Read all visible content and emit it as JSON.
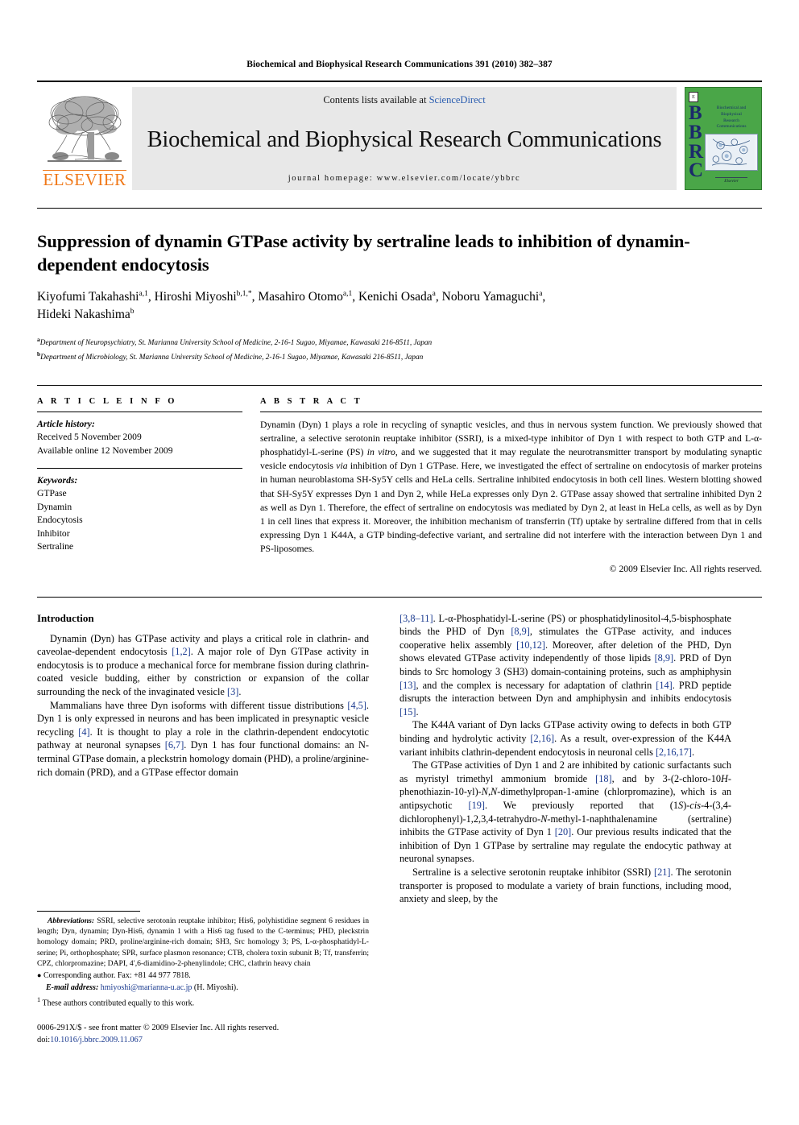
{
  "running_head": "Biochemical and Biophysical Research Communications 391 (2010) 382–387",
  "masthead": {
    "contents_prefix": "Contents lists available at ",
    "sciencedirect": "ScienceDirect",
    "journal_title": "Biochemical and Biophysical Research Communications",
    "homepage": "journal homepage: www.elsevier.com/locate/ybbrc",
    "elsevier_wordmark": "ELSEVIER",
    "cover": {
      "letters": "BBRC",
      "name_lines": [
        "Biochemical and",
        "Biophysical",
        "Research",
        "Communications"
      ],
      "publisher": "Elsevier",
      "bg_color": "#4aa648",
      "letter_color": "#1b2a6b"
    },
    "sciencedirect_color": "#2a5db0",
    "elsevier_orange": "#F07818"
  },
  "article": {
    "title": "Suppression of dynamin GTPase activity by sertraline leads to inhibition of dynamin-dependent endocytosis",
    "authors_line_1": "Kiyofumi Takahashi a,1, Hiroshi Miyoshi b,1,*, Masahiro Otomo a,1, Kenichi Osada a, Noboru Yamaguchi a,",
    "authors_line_2": "Hideki Nakashima b",
    "authors": [
      {
        "name": "Kiyofumi Takahashi",
        "sup": "a,1"
      },
      {
        "name": "Hiroshi Miyoshi",
        "sup": "b,1,*"
      },
      {
        "name": "Masahiro Otomo",
        "sup": "a,1"
      },
      {
        "name": "Kenichi Osada",
        "sup": "a"
      },
      {
        "name": "Noboru Yamaguchi",
        "sup": "a"
      },
      {
        "name": "Hideki Nakashima",
        "sup": "b"
      }
    ],
    "affiliations": [
      {
        "mark": "a",
        "text": "Department of Neuropsychiatry, St. Marianna University School of Medicine, 2-16-1 Sugao, Miyamae, Kawasaki 216-8511, Japan"
      },
      {
        "mark": "b",
        "text": "Department of Microbiology, St. Marianna University School of Medicine, 2-16-1 Sugao, Miyamae, Kawasaki 216-8511, Japan"
      }
    ]
  },
  "article_info": {
    "heading": "A R T I C L E    I N F O",
    "history_label": "Article history:",
    "history": [
      "Received 5 November 2009",
      "Available online 12 November 2009"
    ],
    "keywords_label": "Keywords:",
    "keywords": [
      "GTPase",
      "Dynamin",
      "Endocytosis",
      "Inhibitor",
      "Sertraline"
    ]
  },
  "abstract": {
    "heading": "A B S T R A C T",
    "text_parts": [
      {
        "t": "Dynamin (Dyn) 1 plays a role in recycling of synaptic vesicles, and thus in nervous system function. We previously showed that sertraline, a selective serotonin reuptake inhibitor (SSRI), is a mixed-type inhibitor of Dyn 1 with respect to both GTP and L-α-phosphatidyl-L-serine (PS) ",
        "style": "normal"
      },
      {
        "t": "in vitro",
        "style": "italic"
      },
      {
        "t": ", and we suggested that it may regulate the neurotransmitter transport by modulating synaptic vesicle endocytosis ",
        "style": "normal"
      },
      {
        "t": "via",
        "style": "italic"
      },
      {
        "t": " inhibition of Dyn 1 GTPase. Here, we investigated the effect of sertraline on endocytosis of marker proteins in human neuroblastoma SH-Sy5Y cells and HeLa cells. Sertraline inhibited endocytosis in both cell lines. Western blotting showed that SH-Sy5Y expresses Dyn 1 and Dyn 2, while HeLa expresses only Dyn 2. GTPase assay showed that sertraline inhibited Dyn 2 as well as Dyn 1. Therefore, the effect of sertraline on endocytosis was mediated by Dyn 2, at least in HeLa cells, as well as by Dyn 1 in cell lines that express it. Moreover, the inhibition mechanism of transferrin (Tf) uptake by sertraline differed from that in cells expressing Dyn 1 K44A, a GTP binding-defective variant, and sertraline did not interfere with the interaction between Dyn 1 and PS-liposomes.",
        "style": "normal"
      }
    ],
    "copyright": "© 2009 Elsevier Inc. All rights reserved."
  },
  "body": {
    "left_heading": "Introduction",
    "left_paragraphs": [
      [
        {
          "t": "Dynamin (Dyn) has GTPase activity and plays a critical role in clathrin- and caveolae-dependent endocytosis ",
          "style": "normal"
        },
        {
          "t": "[1,2]",
          "style": "ref"
        },
        {
          "t": ". A major role of Dyn GTPase activity in endocytosis is to produce a mechanical force for membrane fission during clathrin-coated vesicle budding, either by constriction or expansion of the collar surrounding the neck of the invaginated vesicle ",
          "style": "normal"
        },
        {
          "t": "[3]",
          "style": "ref"
        },
        {
          "t": ".",
          "style": "normal"
        }
      ],
      [
        {
          "t": "Mammalians have three Dyn isoforms with different tissue distributions ",
          "style": "normal"
        },
        {
          "t": "[4,5]",
          "style": "ref"
        },
        {
          "t": ". Dyn 1 is only expressed in neurons and has been implicated in presynaptic vesicle recycling ",
          "style": "normal"
        },
        {
          "t": "[4]",
          "style": "ref"
        },
        {
          "t": ". It is thought to play a role in the clathrin-dependent endocytotic pathway at neuronal synapses ",
          "style": "normal"
        },
        {
          "t": "[6,7]",
          "style": "ref"
        },
        {
          "t": ". Dyn 1 has four functional domains: an N-terminal GTPase domain, a pleckstrin homology domain (PHD), a proline/arginine-rich domain (PRD), and a GTPase effector domain",
          "style": "normal"
        }
      ]
    ],
    "right_paragraphs": [
      [
        {
          "t": "[3,8–11]",
          "style": "ref"
        },
        {
          "t": ". L-α-Phosphatidyl-L-serine (PS) or phosphatidylinositol-4,5-bisphosphate binds the PHD of Dyn ",
          "style": "normal"
        },
        {
          "t": "[8,9]",
          "style": "ref"
        },
        {
          "t": ", stimulates the GTPase activity, and induces cooperative helix assembly ",
          "style": "normal"
        },
        {
          "t": "[10,12]",
          "style": "ref"
        },
        {
          "t": ". Moreover, after deletion of the PHD, Dyn shows elevated GTPase activity independently of those lipids ",
          "style": "normal"
        },
        {
          "t": "[8,9]",
          "style": "ref"
        },
        {
          "t": ". PRD of Dyn binds to Src homology 3 (SH3) domain-containing proteins, such as amphiphysin ",
          "style": "normal"
        },
        {
          "t": "[13]",
          "style": "ref"
        },
        {
          "t": ", and the complex is necessary for adaptation of clathrin ",
          "style": "normal"
        },
        {
          "t": "[14]",
          "style": "ref"
        },
        {
          "t": ". PRD peptide disrupts the interaction between Dyn and amphiphysin and inhibits endocytosis ",
          "style": "normal"
        },
        {
          "t": "[15]",
          "style": "ref"
        },
        {
          "t": ".",
          "style": "normal"
        }
      ],
      [
        {
          "t": "The K44A variant of Dyn lacks GTPase activity owing to defects in both GTP binding and hydrolytic activity ",
          "style": "normal"
        },
        {
          "t": "[2,16]",
          "style": "ref"
        },
        {
          "t": ". As a result, over-expression of the K44A variant inhibits clathrin-dependent endocytosis in neuronal cells ",
          "style": "normal"
        },
        {
          "t": "[2,16,17]",
          "style": "ref"
        },
        {
          "t": ".",
          "style": "normal"
        }
      ],
      [
        {
          "t": "The GTPase activities of Dyn 1 and 2 are inhibited by cationic surfactants such as myristyl trimethyl ammonium bromide ",
          "style": "normal"
        },
        {
          "t": "[18]",
          "style": "ref"
        },
        {
          "t": ", and by 3-(2-chloro-10",
          "style": "normal"
        },
        {
          "t": "H",
          "style": "italic"
        },
        {
          "t": "-phenothiazin-10-yl)-",
          "style": "normal"
        },
        {
          "t": "N,N",
          "style": "italic"
        },
        {
          "t": "-dimethylpropan-1-amine (chlorpromazine), which is an antipsychotic ",
          "style": "normal"
        },
        {
          "t": "[19]",
          "style": "ref"
        },
        {
          "t": ". We previously reported that (1",
          "style": "normal"
        },
        {
          "t": "S",
          "style": "italic"
        },
        {
          "t": ")-",
          "style": "normal"
        },
        {
          "t": "cis",
          "style": "italic"
        },
        {
          "t": "-4-(3,4-dichlorophenyl)-1,2,3,4-tetrahydro-",
          "style": "normal"
        },
        {
          "t": "N",
          "style": "italic"
        },
        {
          "t": "-methyl-1-naphthalenamine (sertraline) inhibits the GTPase activity of Dyn 1 ",
          "style": "normal"
        },
        {
          "t": "[20]",
          "style": "ref"
        },
        {
          "t": ". Our previous results indicated that the inhibition of Dyn 1 GTPase by sertraline may regulate the endocytic pathway at neuronal synapses.",
          "style": "normal"
        }
      ],
      [
        {
          "t": "Sertraline is a selective serotonin reuptake inhibitor (SSRI) ",
          "style": "normal"
        },
        {
          "t": "[21]",
          "style": "ref"
        },
        {
          "t": ". The serotonin transporter is proposed to modulate a variety of brain functions, including mood, anxiety and sleep, by the",
          "style": "normal"
        }
      ]
    ]
  },
  "footnotes": {
    "abbrev_label": "Abbreviations:",
    "abbrev_text": " SSRI, selective serotonin reuptake inhibitor; His6, polyhistidine segment 6 residues in length; Dyn, dynamin; Dyn-His6, dynamin 1 with a His6 tag fused to the C-terminus; PHD, pleckstrin homology domain; PRD, proline/arginine-rich domain; SH3, Src homology 3; PS, L-α-phosphatidyl-L-serine; Pi, orthophosphate; SPR, surface plasmon resonance; CTB, cholera toxin subunit B; Tf, transferrin; CPZ, chlorpromazine; DAPI, 4′,6-diamidino-2-phenylindole; CHC, clathrin heavy chain",
    "corresponding": "Corresponding author. Fax: +81 44 977 7818.",
    "email_label": "E-mail address:",
    "email": "hmiyoshi@marianna-u.ac.jp",
    "email_suffix": " (H. Miyoshi).",
    "equal_contrib_mark": "1",
    "equal_contrib": "These authors contributed equally to this work.",
    "imprint": "0006-291X/$ - see front matter © 2009 Elsevier Inc. All rights reserved.",
    "doi_label": "doi:",
    "doi": "10.1016/j.bbrc.2009.11.067"
  }
}
